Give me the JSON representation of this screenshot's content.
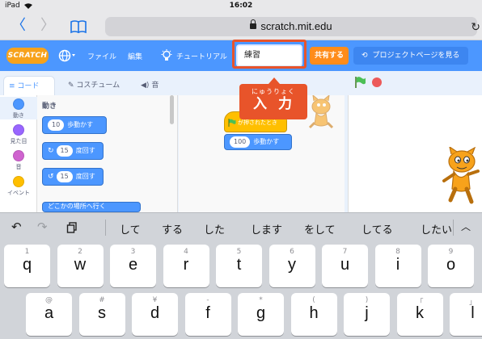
{
  "status": {
    "device": "iPad",
    "time": "16:02"
  },
  "browser": {
    "url": "scratch.mit.edu",
    "back": "〈",
    "forward": "〉",
    "reload": "↻"
  },
  "menubar": {
    "logo": "SCRATCH",
    "file": "ファイル",
    "edit": "編集",
    "tutorials": "チュートリアル",
    "title_value": "練習",
    "share": "共有する",
    "project_page": "プロジェクトページを見る"
  },
  "tabs": {
    "code": "コード",
    "costumes": "コスチューム",
    "sounds": "音"
  },
  "categories": [
    {
      "label": "動き",
      "color": "#4c97ff"
    },
    {
      "label": "見た目",
      "color": "#9966ff"
    },
    {
      "label": "音",
      "color": "#cf63cf"
    },
    {
      "label": "イベント",
      "color": "#ffbf00"
    }
  ],
  "palette": {
    "heading": "動き",
    "blocks": [
      {
        "value": "10",
        "text": "歩動かす"
      },
      {
        "value": "15",
        "text": "度回す"
      },
      {
        "value": "15",
        "text": "度回す"
      },
      {
        "value": "",
        "text": "どこかの場所へ行く"
      }
    ]
  },
  "workspace": {
    "hat_text": "が押されたとき",
    "move_value": "100",
    "move_text": "歩動かす"
  },
  "callout": {
    "ruby": "にゅうりょく",
    "text": "入力"
  },
  "keyboard": {
    "suggestions": [
      "して",
      "する",
      "した",
      "します",
      "をして",
      "してる",
      "したい"
    ],
    "row1": [
      {
        "hint": "1",
        "key": "q"
      },
      {
        "hint": "2",
        "key": "w"
      },
      {
        "hint": "3",
        "key": "e"
      },
      {
        "hint": "4",
        "key": "r"
      },
      {
        "hint": "5",
        "key": "t"
      },
      {
        "hint": "6",
        "key": "y"
      },
      {
        "hint": "7",
        "key": "u"
      },
      {
        "hint": "8",
        "key": "i"
      },
      {
        "hint": "9",
        "key": "o"
      }
    ],
    "row2": [
      {
        "hint": "@",
        "key": "a"
      },
      {
        "hint": "#",
        "key": "s"
      },
      {
        "hint": "¥",
        "key": "d"
      },
      {
        "hint": "-",
        "key": "f"
      },
      {
        "hint": "*",
        "key": "g"
      },
      {
        "hint": "(",
        "key": "h"
      },
      {
        "hint": ")",
        "key": "j"
      },
      {
        "hint": "「",
        "key": "k"
      },
      {
        "hint": "」",
        "key": "l"
      }
    ]
  }
}
